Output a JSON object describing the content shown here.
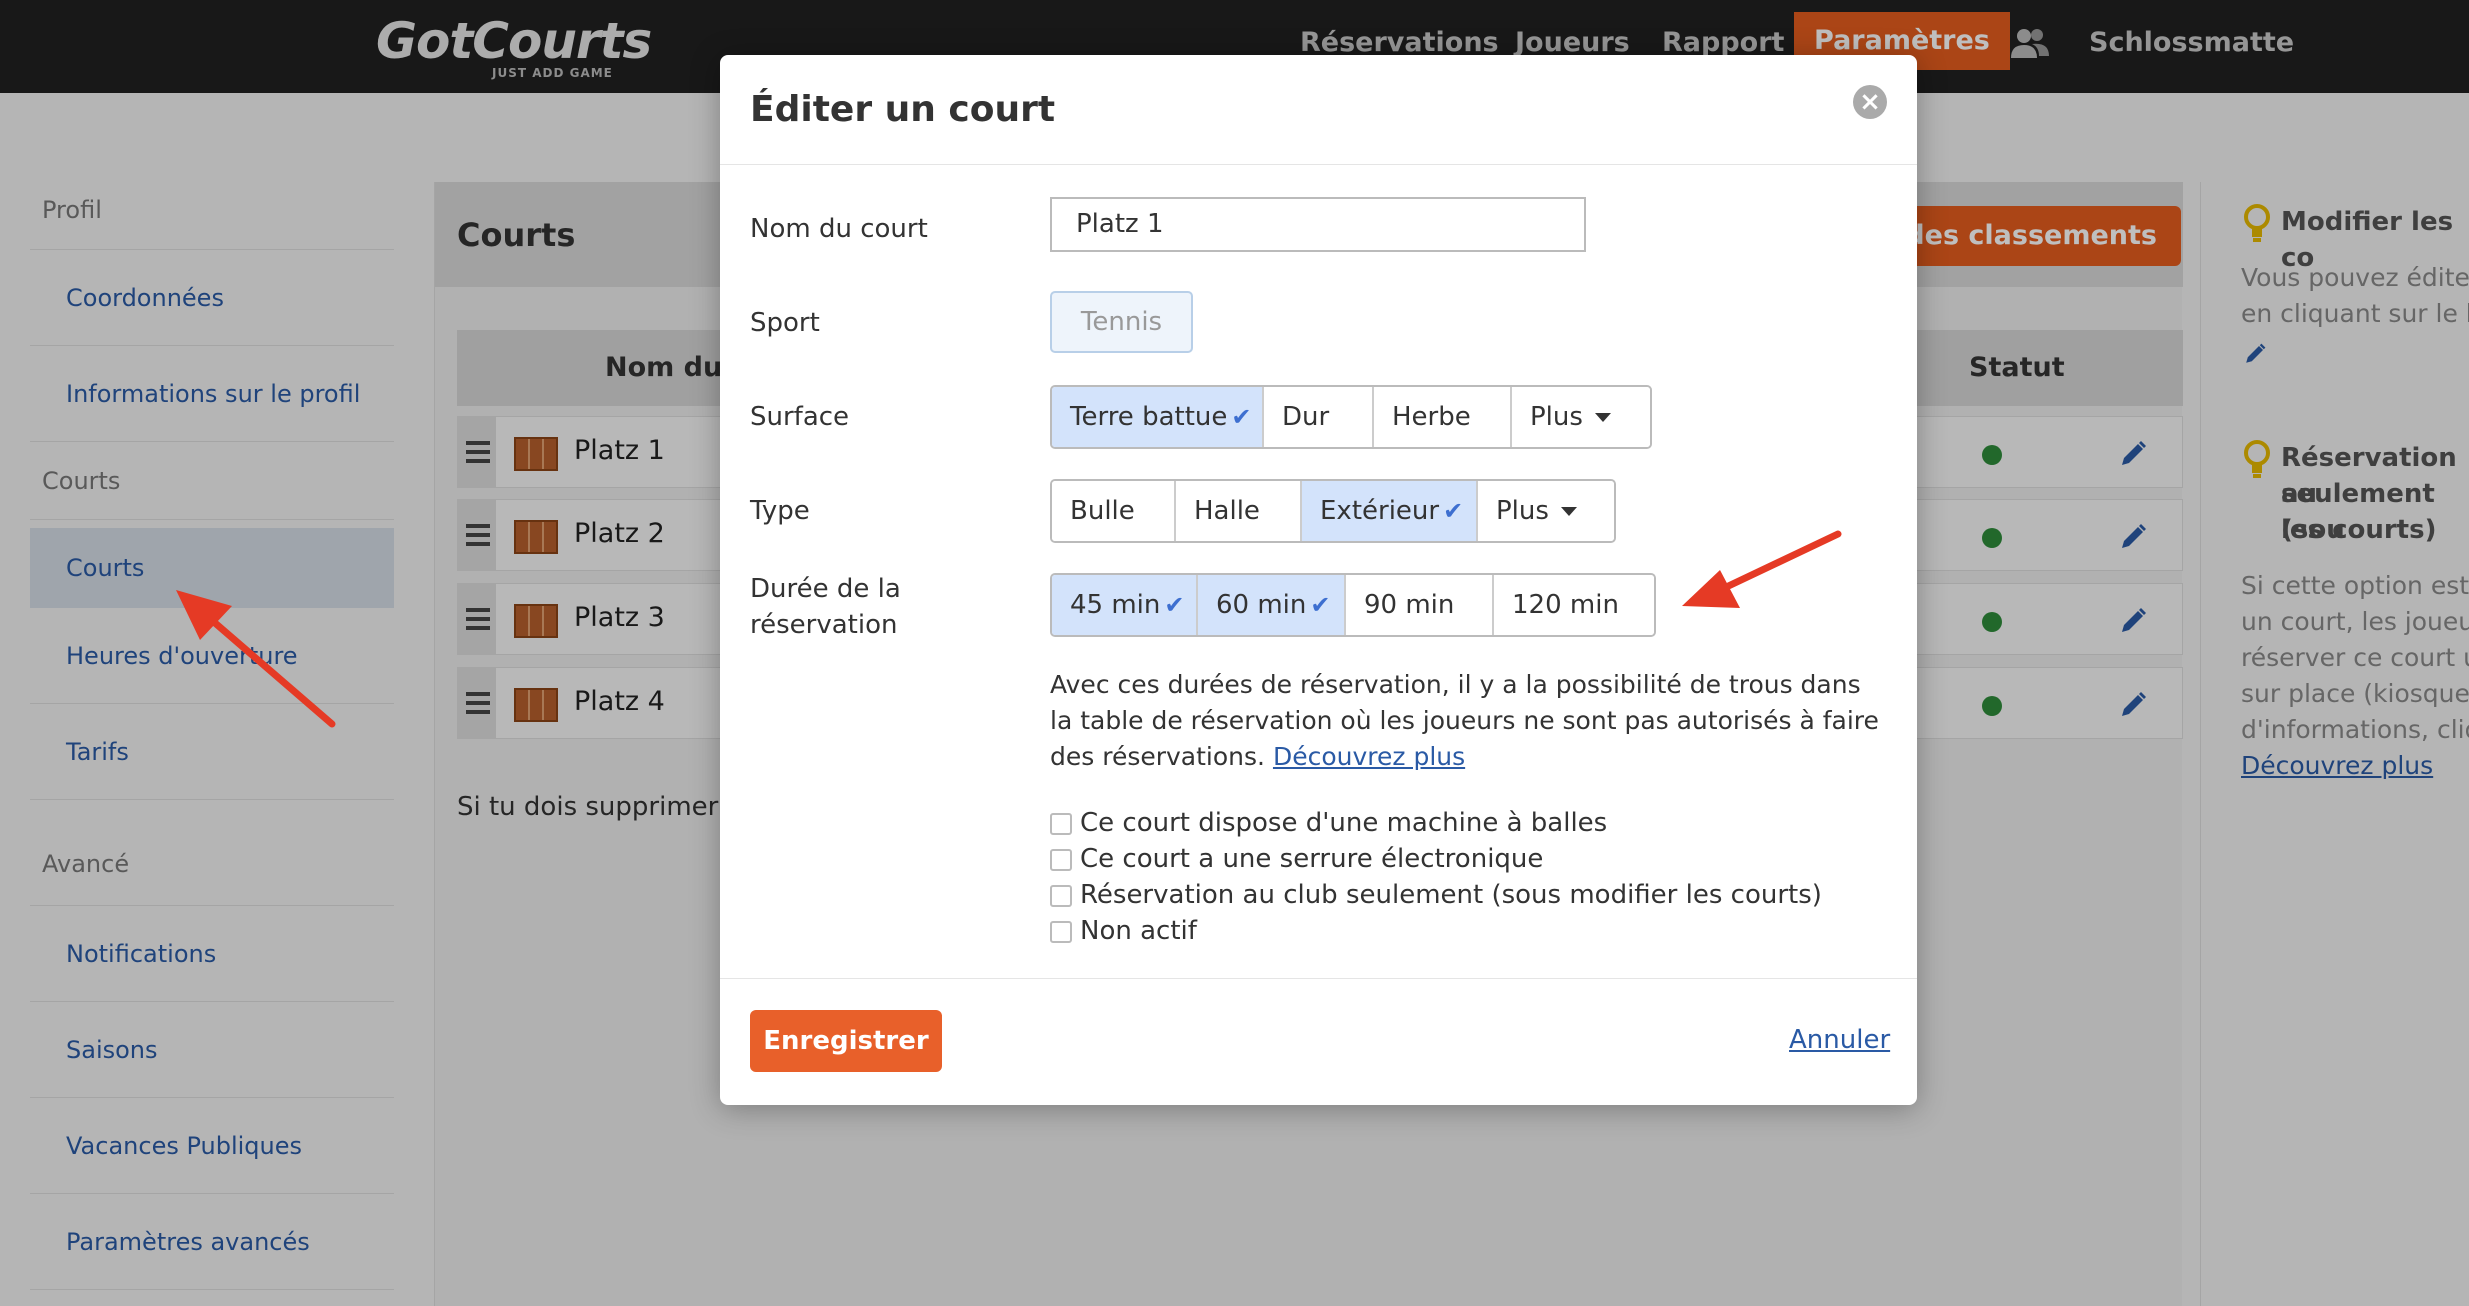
{
  "app": {
    "logo": "GotCourts",
    "tagline": "JUST ADD GAME"
  },
  "nav": {
    "items": [
      "Réservations",
      "Joueurs",
      "Rapport",
      "Paramètres"
    ],
    "active": "Paramètres",
    "club_name": "Schlossmatte",
    "users_icon": "users-icon"
  },
  "sidebar": {
    "sections": [
      {
        "title": "Profil",
        "items": [
          "Coordonnées",
          "Informations sur le profil"
        ]
      },
      {
        "title": "Courts",
        "items": [
          "Courts",
          "Heures d'ouverture",
          "Tarifs"
        ]
      },
      {
        "title": "Avancé",
        "items": [
          "Notifications",
          "Saisons",
          "Vacances Publiques",
          "Paramètres avancés"
        ]
      }
    ],
    "active": "Courts"
  },
  "main": {
    "title": "Courts",
    "rank_button": "er des classements",
    "columns": {
      "name": "Nom du co",
      "status": "Statut"
    },
    "rows": [
      {
        "name": "Platz 1",
        "status": "active"
      },
      {
        "name": "Platz 2",
        "status": "active"
      },
      {
        "name": "Platz 3",
        "status": "active"
      },
      {
        "name": "Platz 4",
        "status": "active"
      }
    ],
    "note": "Si tu dois supprimer l'"
  },
  "right_panel": {
    "tip1_title": "Modifier les co",
    "tip1_lines": [
      "Vous pouvez éditer",
      "en cliquant sur le b"
    ],
    "tip2_title_lines": [
      "Réservation au",
      "seulement (sou",
      "les courts)"
    ],
    "tip2_lines": [
      "Si cette option est a",
      "un court, les joueur",
      "réserver ce court u",
      "sur place (kiosque)",
      "d'informations, cliq"
    ],
    "tip2_link": "Découvrez plus"
  },
  "modal": {
    "title": "Éditer un court",
    "fields": {
      "name_label": "Nom du court",
      "name_value": "Platz 1",
      "sport_label": "Sport",
      "sport_value": "Tennis",
      "surface_label": "Surface",
      "surface_options": [
        "Terre battue",
        "Dur",
        "Herbe",
        "Plus"
      ],
      "surface_selected": [
        "Terre battue"
      ],
      "type_label": "Type",
      "type_options": [
        "Bulle",
        "Halle",
        "Extérieur",
        "Plus"
      ],
      "type_selected": [
        "Extérieur"
      ],
      "duration_label_line1": "Durée de la",
      "duration_label_line2": "réservation",
      "duration_options": [
        "45 min",
        "60 min",
        "90 min",
        "120 min"
      ],
      "duration_selected": [
        "45 min",
        "60 min"
      ]
    },
    "help_text": "Avec ces durées de réservation, il y a la possibilité de trous dans la table de réservation où les joueurs ne sont pas autorisés à faire des réservations.",
    "help_link": "Découvrez plus",
    "checkboxes": [
      {
        "label": "Ce court dispose d'une machine à balles",
        "checked": false
      },
      {
        "label": "Ce court a une serrure électronique",
        "checked": false
      },
      {
        "label": "Réservation au club seulement (sous modifier les courts)",
        "checked": false
      },
      {
        "label": "Non actif",
        "checked": false
      }
    ],
    "save_label": "Enregistrer",
    "cancel_label": "Annuler"
  },
  "colors": {
    "accent": "#e45c1e",
    "link": "#2a5aa5",
    "selected": "#d3e3fb",
    "status_active": "#2e8b3a",
    "arrow": "#e53a25"
  }
}
